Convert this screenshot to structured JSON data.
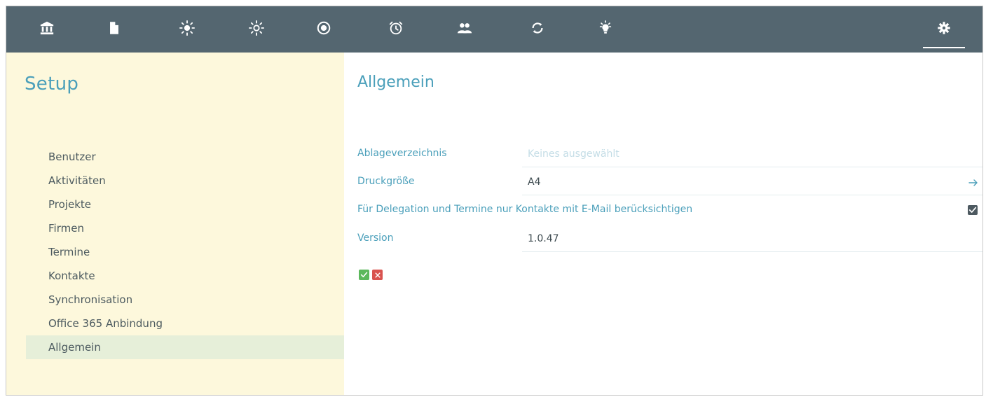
{
  "toolbar": {
    "icons": [
      {
        "name": "bank-icon"
      },
      {
        "name": "document-icon"
      },
      {
        "name": "sun-icon"
      },
      {
        "name": "sun-outline-icon"
      },
      {
        "name": "target-icon"
      },
      {
        "name": "alarm-clock-icon"
      },
      {
        "name": "people-icon"
      },
      {
        "name": "sync-icon"
      },
      {
        "name": "lightbulb-icon"
      }
    ],
    "settings_icon": "gear-icon",
    "active": "settings",
    "bg_color": "#546670"
  },
  "sidebar": {
    "title": "Setup",
    "items": [
      {
        "label": "Benutzer"
      },
      {
        "label": "Aktivitäten"
      },
      {
        "label": "Projekte"
      },
      {
        "label": "Firmen"
      },
      {
        "label": "Termine"
      },
      {
        "label": "Kontakte"
      },
      {
        "label": "Synchronisation"
      },
      {
        "label": "Office 365 Anbindung"
      },
      {
        "label": "Allgemein"
      }
    ],
    "active_item": "Allgemein",
    "bg_color": "#fdf8dc",
    "active_bg_color": "#e6efd9"
  },
  "main": {
    "title": "Allgemein",
    "fields": {
      "storage_dir": {
        "label": "Ablageverzeichnis",
        "value": "",
        "placeholder": "Keines ausgewählt"
      },
      "print_size": {
        "label": "Druckgröße",
        "value": "A4",
        "icon": "arrow-right-icon"
      },
      "contacts_with_email": {
        "label": "Für Delegation und Termine nur Kontakte mit E-Mail berücksichtigen",
        "checked": true
      },
      "version": {
        "label": "Version",
        "value": "1.0.47"
      }
    },
    "actions": {
      "confirm_icon": "check-icon",
      "cancel_icon": "close-icon",
      "confirm_color": "#5cb85c",
      "cancel_color": "#d9534f"
    },
    "accent_color": "#4a9fba"
  }
}
